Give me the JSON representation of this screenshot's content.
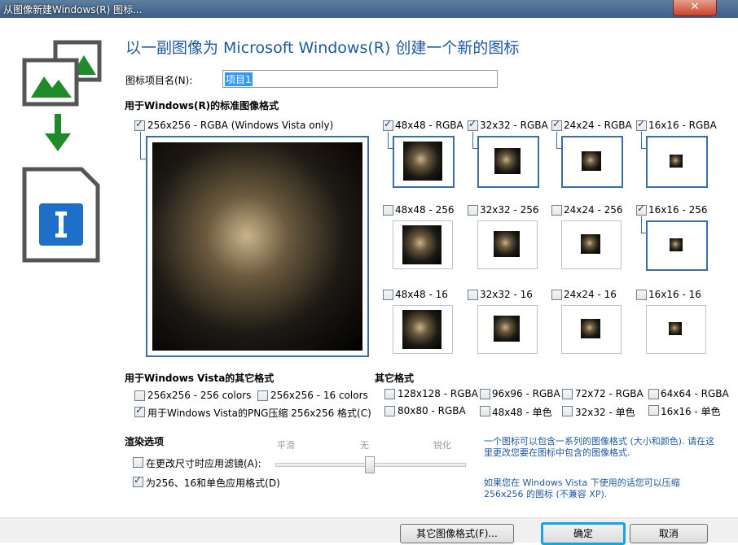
{
  "window": {
    "title": "从图像新建Windows(R) 图标...",
    "close": "✕"
  },
  "heading": "以一副图像为 Microsoft Windows(R) 创建一个新的图标",
  "name_field": {
    "label": "图标项目名(N):",
    "value": "项目1"
  },
  "standard_section": {
    "title": "用于Windows(R)的标准图像格式",
    "large": {
      "label": "256x256 - RGBA (Windows Vista only)",
      "checked": true
    },
    "formats": [
      {
        "label": "48x48 - RGBA",
        "checked": true
      },
      {
        "label": "32x32 - RGBA",
        "checked": true
      },
      {
        "label": "24x24 - RGBA",
        "checked": true
      },
      {
        "label": "16x16 - RGBA",
        "checked": true
      },
      {
        "label": "48x48 - 256",
        "checked": false
      },
      {
        "label": "32x32 - 256",
        "checked": false
      },
      {
        "label": "24x24 - 256",
        "checked": false
      },
      {
        "label": "16x16 - 256",
        "checked": true
      },
      {
        "label": "48x48 - 16",
        "checked": false
      },
      {
        "label": "32x32 - 16",
        "checked": false
      },
      {
        "label": "24x24 - 16",
        "checked": false
      },
      {
        "label": "16x16 - 16",
        "checked": false
      }
    ]
  },
  "vista_section": {
    "title": "用于Windows Vista的其它格式",
    "items": [
      {
        "label": "256x256 - 256 colors",
        "checked": false
      },
      {
        "label": "256x256 - 16 colors",
        "checked": false
      },
      {
        "label": "用于Windows Vista的PNG压缩 256x256 格式(C)",
        "checked": true
      }
    ]
  },
  "other_section": {
    "title": "其它格式",
    "items": [
      {
        "label": "128x128 - RGBA",
        "checked": false
      },
      {
        "label": "96x96 - RGBA",
        "checked": false
      },
      {
        "label": "72x72 - RGBA",
        "checked": false
      },
      {
        "label": "64x64 - RGBA",
        "checked": false
      },
      {
        "label": "80x80 - RGBA",
        "checked": false
      },
      {
        "label": "48x48 - 单色",
        "checked": false
      },
      {
        "label": "32x32 - 单色",
        "checked": false
      },
      {
        "label": "16x16 - 单色",
        "checked": false
      }
    ]
  },
  "render_section": {
    "title": "渲染选项",
    "slider_labels": [
      "平滑",
      "无",
      "锐化"
    ],
    "options": [
      {
        "label": "在更改尺寸时应用滤镜(A):",
        "checked": false
      },
      {
        "label": "为256、16和单色应用格式(D)",
        "checked": true
      }
    ]
  },
  "info": {
    "text1": "一个图标可以包含一系列的图像格式 (大小和颜色). 请在这里更改您要在图标中包含的图像格式.",
    "text2": "如果您在 Windows Vista 下使用的话您可以压缩 256x256 的图标 (不兼容 XP)."
  },
  "buttons": {
    "other": "其它图像格式(F)...",
    "ok": "确定",
    "cancel": "取消"
  }
}
